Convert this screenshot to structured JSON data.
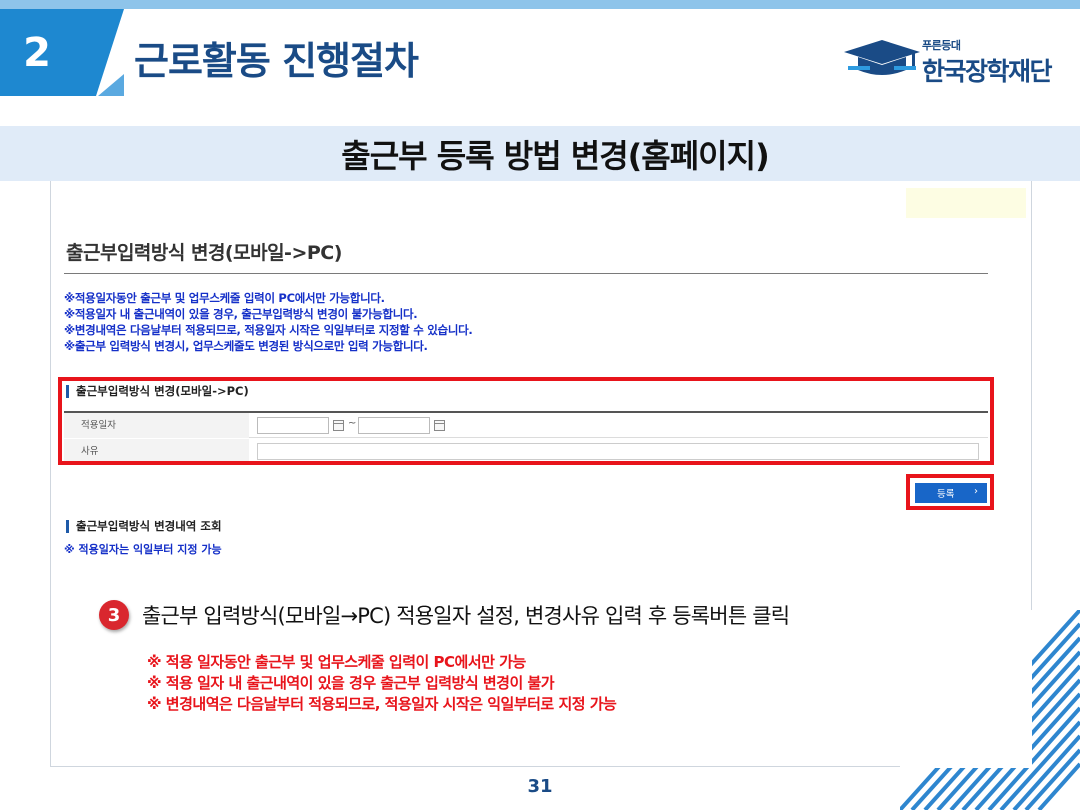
{
  "header": {
    "chapter_number": "2",
    "title": "근로활동 진행절차",
    "logo": {
      "tagline": "푸른등대",
      "name": "한국장학재단"
    }
  },
  "subtitle": "출근부 등록 방법 변경(홈페이지)",
  "screenshot": {
    "page_heading": "출근부입력방식 변경(모바일->PC)",
    "notices": [
      "※적용일자동안 출근부 및 업무스케줄 입력이 PC에서만 가능합니다.",
      "※적용일자 내 출근내역이 있을 경우, 출근부입력방식 변경이 불가능합니다.",
      "※변경내역은 다음날부터 적용되므로, 적용일자 시작은 익일부터로 지정할 수 있습니다.",
      "※출근부 입력방식 변경시, 업무스케줄도 변경된 방식으로만 입력 가능합니다."
    ],
    "form": {
      "section_title": "출근부입력방식 변경(모바일->PC)",
      "date_label": "적용일자",
      "date_start_value": "",
      "date_end_value": "",
      "date_separator": "~",
      "reason_label": "사유",
      "reason_value": ""
    },
    "register_button": {
      "label": "등록",
      "chevron": "›"
    },
    "history": {
      "title": "출근부입력방식 변경내역 조회",
      "note": "※ 적용일자는 익일부터 지정 가능"
    }
  },
  "step": {
    "number": "3",
    "text": "출근부 입력방식(모바일→PC) 적용일자 설정, 변경사유 입력 후 등록버튼 클릭"
  },
  "warnings": [
    "※ 적용 일자동안 출근부 및 업무스케줄 입력이 PC에서만 가능",
    "※ 적용 일자 내 출근내역이 있을 경우 출근부 입력방식 변경이 불가",
    "※ 변경내역은 다음날부터 적용되므로, 적용일자 시작은 익일부터로 지정 가능"
  ],
  "page_number": "31",
  "colors": {
    "brand_blue": "#1e88d0",
    "navy": "#1a4b86",
    "highlight_red": "#e8141b",
    "notice_blue": "#1530c8",
    "button_blue": "#1866c8"
  },
  "icons": {
    "logo": "graduation-cap-icon",
    "date_picker": "calendar-icon",
    "button_arrow": "chevron-right-icon"
  }
}
